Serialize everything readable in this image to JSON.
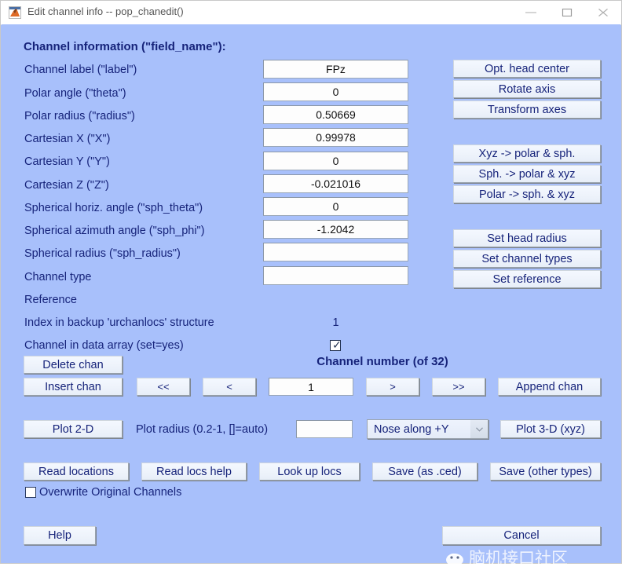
{
  "window": {
    "title": "Edit channel info -- pop_chanedit()",
    "app_icon": "matlab-icon",
    "minimize_label": "–",
    "maximize_label": "□",
    "close_label": "×",
    "background_color": "#a8c0fb",
    "text_color": "#16237a"
  },
  "section_header": "Channel information (\"field_name\"):",
  "fields": [
    {
      "label": "Channel label (\"label\")",
      "value": "FPz"
    },
    {
      "label": "Polar angle (\"theta\")",
      "value": "0"
    },
    {
      "label": "Polar radius (\"radius\")",
      "value": "0.50669"
    },
    {
      "label": "Cartesian X (\"X\")",
      "value": "0.99978"
    },
    {
      "label": "Cartesian Y (\"Y\")",
      "value": "0"
    },
    {
      "label": "Cartesian Z (\"Z\")",
      "value": "-0.021016"
    },
    {
      "label": "Spherical horiz. angle (\"sph_theta\")",
      "value": "0"
    },
    {
      "label": "Spherical azimuth angle (\"sph_phi\")",
      "value": "-1.2042"
    },
    {
      "label": "Spherical radius (\"sph_radius\")",
      "value": ""
    },
    {
      "label": "Channel type",
      "value": ""
    },
    {
      "label": "Reference",
      "value": ""
    }
  ],
  "index_row": {
    "label": "Index in backup 'urchanlocs' structure",
    "value": "1"
  },
  "in_data_row": {
    "label": "Channel in data array (set=yes)",
    "checked": true
  },
  "right_buttons": {
    "group1": [
      "Opt. head center",
      "Rotate axis",
      "Transform axes"
    ],
    "group2": [
      "Xyz -> polar & sph.",
      "Sph. -> polar & xyz",
      "Polar -> sph. & xyz"
    ],
    "group3": [
      "Set head radius",
      "Set channel types",
      "Set reference"
    ]
  },
  "channel_nav": {
    "delete_label": "Delete chan",
    "insert_label": "Insert chan",
    "first_label": "<<",
    "prev_label": "<",
    "number_value": "1",
    "next_label": ">",
    "last_label": ">>",
    "append_label": "Append chan",
    "title": "Channel number (of 32)"
  },
  "plot_row": {
    "plot2d_label": "Plot 2-D",
    "radius_label": "Plot radius (0.2-1, []=auto)",
    "radius_value": "",
    "nose_value": "Nose along +Y",
    "nose_arrow": "⌄",
    "plot3d_label": "Plot 3-D (xyz)"
  },
  "io_row": {
    "read_locations_label": "Read locations",
    "read_locs_help_label": "Read locs help",
    "look_up_locs_label": "Look up locs",
    "save_ced_label": "Save (as .ced)",
    "save_other_label": "Save (other types)",
    "overwrite_label": "Overwrite Original Channels",
    "overwrite_checked": false
  },
  "footer": {
    "help_label": "Help",
    "cancel_label": "Cancel"
  },
  "watermark": {
    "text": "脑机接口社区",
    "logo": "brain-logo-icon"
  }
}
